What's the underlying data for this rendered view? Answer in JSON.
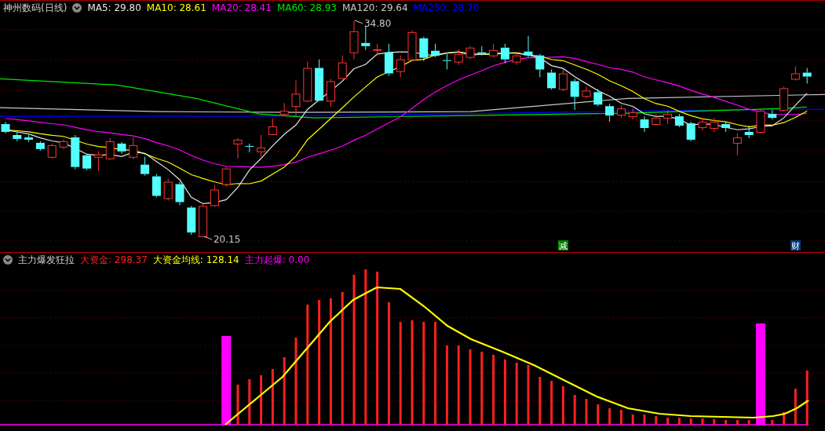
{
  "price_panel": {
    "title": "神州数码(日线)",
    "indicators": [
      {
        "label": "MA5: 29.80",
        "color": "#e6e6e6"
      },
      {
        "label": "MA10: 28.61",
        "color": "#ffff00"
      },
      {
        "label": "MA20: 28.41",
        "color": "#ff00ff"
      },
      {
        "label": "MA60: 28.93",
        "color": "#00e600"
      },
      {
        "label": "MA120: 29.64",
        "color": "#c8c8c8"
      },
      {
        "label": "MA250: 28.70",
        "color": "#0000ff"
      }
    ],
    "high_label": "34.80",
    "low_label": "20.15",
    "signals": [
      {
        "label": "减",
        "color": "#008000"
      },
      {
        "label": "财",
        "color": "#003a80"
      }
    ]
  },
  "indicator_panel": {
    "title": "主力爆发狂拉",
    "indicators": [
      {
        "label": "大资金: 298.37",
        "color": "#ff2020"
      },
      {
        "label": "大资金均线: 128.14",
        "color": "#ffff00"
      },
      {
        "label": "主力起爆: 0.00",
        "color": "#ff00ff"
      }
    ]
  }
}
